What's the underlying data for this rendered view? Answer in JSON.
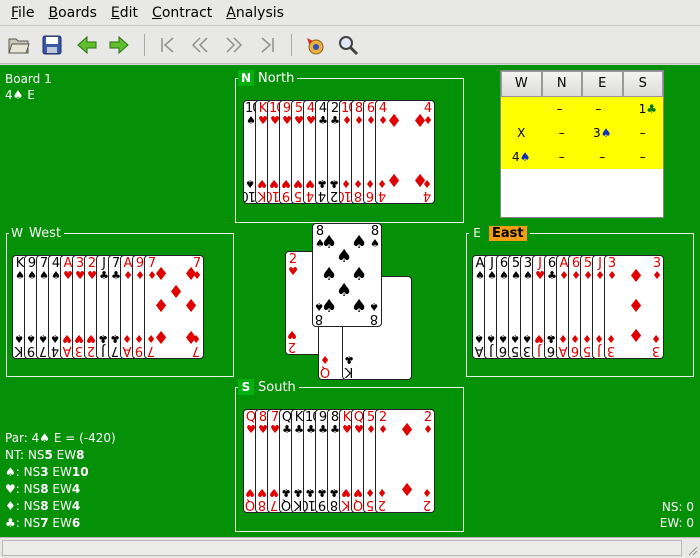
{
  "menu": [
    {
      "key": "F",
      "rest": "ile"
    },
    {
      "key": "B",
      "rest": "oards"
    },
    {
      "key": "E",
      "rest": "dit"
    },
    {
      "key": "C",
      "rest": "ontract"
    },
    {
      "key": "A",
      "rest": "nalysis"
    }
  ],
  "toolbar": [
    "open-icon",
    "save-icon",
    "back-icon",
    "forward-icon",
    "first-card-icon",
    "prev-card-icon",
    "next-card-icon",
    "last-card-icon",
    "dd-solver-icon",
    "search-icon"
  ],
  "info": {
    "board": "Board 1",
    "contract": "4♠ E"
  },
  "seats": {
    "north": {
      "badge": "N",
      "name": "North"
    },
    "west": {
      "badge": "W",
      "name": "West"
    },
    "east": {
      "badge": "E",
      "name": "East"
    },
    "south": {
      "badge": "S",
      "name": "South"
    }
  },
  "bidding": {
    "headers": [
      "W",
      "N",
      "E",
      "S"
    ],
    "rows": [
      [
        "",
        "–",
        "–",
        "1♣"
      ],
      [
        "X",
        "–",
        "3♠",
        "–"
      ],
      [
        "4♠",
        "–",
        "–",
        "–"
      ]
    ]
  },
  "par": {
    "line": "Par: 4♠ E = (-420)",
    "rows": [
      {
        "suit": "NT",
        "ns": "NS",
        "nsv": "5",
        "ew": "EW",
        "ewv": "8"
      },
      {
        "suit": "♠",
        "ns": "NS",
        "nsv": "3",
        "ew": "EW",
        "ewv": "10"
      },
      {
        "suit": "♥",
        "ns": "NS",
        "nsv": "8",
        "ew": "EW",
        "ewv": "4"
      },
      {
        "suit": "♦",
        "ns": "NS",
        "nsv": "8",
        "ew": "EW",
        "ewv": "4"
      },
      {
        "suit": "♣",
        "ns": "NS",
        "nsv": "7",
        "ew": "EW",
        "ewv": "6"
      }
    ]
  },
  "score": {
    "ns": "NS: 0",
    "ew": "EW: 0"
  },
  "hands": {
    "north": [
      {
        "r": "10",
        "s": "♠"
      },
      {
        "r": "K",
        "s": "♥"
      },
      {
        "r": "10",
        "s": "♥"
      },
      {
        "r": "9",
        "s": "♥"
      },
      {
        "r": "5",
        "s": "♥"
      },
      {
        "r": "4",
        "s": "♥"
      },
      {
        "r": "4",
        "s": "♣"
      },
      {
        "r": "2",
        "s": "♣"
      },
      {
        "r": "10",
        "s": "♦"
      },
      {
        "r": "8",
        "s": "♦"
      },
      {
        "r": "6",
        "s": "♦"
      },
      {
        "r": "4",
        "s": "♦"
      }
    ],
    "west": [
      {
        "r": "K",
        "s": "♠"
      },
      {
        "r": "9",
        "s": "♠"
      },
      {
        "r": "7",
        "s": "♠"
      },
      {
        "r": "4",
        "s": "♠"
      },
      {
        "r": "A",
        "s": "♥"
      },
      {
        "r": "3",
        "s": "♥"
      },
      {
        "r": "2",
        "s": "♥"
      },
      {
        "r": "J",
        "s": "♣"
      },
      {
        "r": "7",
        "s": "♣"
      },
      {
        "r": "A",
        "s": "♦"
      },
      {
        "r": "9",
        "s": "♦"
      },
      {
        "r": "7",
        "s": "♦"
      }
    ],
    "east": [
      {
        "r": "A",
        "s": "♠"
      },
      {
        "r": "J",
        "s": "♠"
      },
      {
        "r": "6",
        "s": "♠"
      },
      {
        "r": "5",
        "s": "♠"
      },
      {
        "r": "3",
        "s": "♠"
      },
      {
        "r": "J",
        "s": "♥"
      },
      {
        "r": "6",
        "s": "♣"
      },
      {
        "r": "A",
        "s": "♦"
      },
      {
        "r": "6",
        "s": "♦"
      },
      {
        "r": "5",
        "s": "♦"
      },
      {
        "r": "J",
        "s": "♦"
      },
      {
        "r": "3",
        "s": "♦"
      }
    ],
    "south": [
      {
        "r": "Q",
        "s": "♥"
      },
      {
        "r": "8",
        "s": "♥"
      },
      {
        "r": "7",
        "s": "♥"
      },
      {
        "r": "Q",
        "s": "♣"
      },
      {
        "r": "K",
        "s": "♣"
      },
      {
        "r": "10",
        "s": "♣"
      },
      {
        "r": "9",
        "s": "♣"
      },
      {
        "r": "8",
        "s": "♣"
      },
      {
        "r": "K",
        "s": "♥"
      },
      {
        "r": "Q",
        "s": "♥"
      },
      {
        "r": "5",
        "s": "♦"
      },
      {
        "r": "2",
        "s": "♦"
      }
    ]
  },
  "trick": [
    {
      "r": "2",
      "s": "♥",
      "seat": "west"
    },
    {
      "r": "8",
      "s": "♠",
      "seat": "north"
    },
    {
      "r": "Q",
      "s": "♦",
      "seat": "south"
    },
    {
      "r": "K",
      "s": "♣",
      "seat": "east"
    }
  ],
  "colors": {
    "felt": "#049107",
    "active": "#f39c12",
    "bidding_bg": "#ffff00",
    "red": "#e00000"
  }
}
